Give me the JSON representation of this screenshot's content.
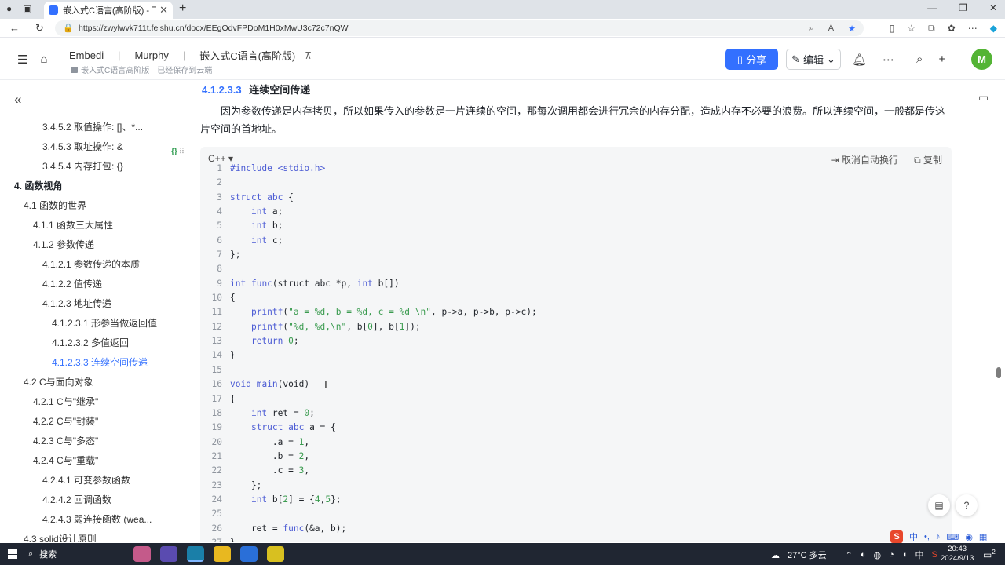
{
  "browser": {
    "tab_title": "嵌入式C语言(高阶版) - 飞书云文档",
    "url": "https://zwylwvk711t.feishu.cn/docx/EEgOdvFPDoM1H0xMwU3c72c7nQW"
  },
  "header": {
    "crumbs": [
      "Embedi",
      "Murphy",
      "嵌入式C语言(高阶版)"
    ],
    "folder": "嵌入式C语言高阶版",
    "save_status": "已经保存到云端",
    "share_label": "分享",
    "edit_label": "编辑",
    "avatar_letter": "M"
  },
  "sidebar": {
    "toc": [
      {
        "label": "3.4.5.2 取值操作: []、*...",
        "level": 3
      },
      {
        "label": "3.4.5.3 取址操作: &",
        "level": 3
      },
      {
        "label": "3.4.5.4 内存打包: {}",
        "level": 3
      },
      {
        "label": "4. 函数视角",
        "level": 0,
        "bold": true
      },
      {
        "label": "4.1 函数的世界",
        "level": 1
      },
      {
        "label": "4.1.1 函数三大属性",
        "level": 2
      },
      {
        "label": "4.1.2 参数传递",
        "level": 2
      },
      {
        "label": "4.1.2.1 参数传递的本质",
        "level": 3
      },
      {
        "label": "4.1.2.2 值传递",
        "level": 3
      },
      {
        "label": "4.1.2.3 地址传递",
        "level": 3
      },
      {
        "label": "4.1.2.3.1 形参当做返回值",
        "level": 4
      },
      {
        "label": "4.1.2.3.2 多值返回",
        "level": 4
      },
      {
        "label": "4.1.2.3.3 连续空间传递",
        "level": 4,
        "active": true
      },
      {
        "label": "4.2 C与面向对象",
        "level": 1
      },
      {
        "label": "4.2.1 C与\"继承\"",
        "level": 2
      },
      {
        "label": "4.2.2 C与\"封装\"",
        "level": 2
      },
      {
        "label": "4.2.3 C与\"多态\"",
        "level": 2
      },
      {
        "label": "4.2.4 C与\"重载\"",
        "level": 2
      },
      {
        "label": "4.2.4.1 可变参数函数",
        "level": 3
      },
      {
        "label": "4.2.4.2 回调函数",
        "level": 3
      },
      {
        "label": "4.2.4.3 弱连接函数 (wea...",
        "level": 3
      },
      {
        "label": "4.3 solid设计原则",
        "level": 1
      }
    ],
    "block_handle": "{}"
  },
  "content": {
    "section_number": "4.1.2.3.3",
    "section_title": "连续空间传递",
    "paragraph": "因为参数传递是内存拷贝，所以如果传入的参数是一片连续的空间，那每次调用都会进行冗余的内存分配，造成内存不必要的浪费。所以连续空间，一般都是传这片空间的首地址。",
    "code": {
      "language": "C++",
      "unwrap_label": "取消自动换行",
      "copy_label": "复制",
      "lines": [
        {
          "n": "1",
          "html": "<span class='kw'>#include</span> <span class='inc'>&lt;stdio.h&gt;</span>"
        },
        {
          "n": "2",
          "html": ""
        },
        {
          "n": "3",
          "html": "<span class='kw'>struct</span> <span class='kw'>abc</span> {"
        },
        {
          "n": "4",
          "html": "    <span class='kw'>int</span> a;"
        },
        {
          "n": "5",
          "html": "    <span class='kw'>int</span> b;"
        },
        {
          "n": "6",
          "html": "    <span class='kw'>int</span> c;"
        },
        {
          "n": "7",
          "html": "};"
        },
        {
          "n": "8",
          "html": ""
        },
        {
          "n": "9",
          "html": "<span class='kw'>int</span> <span class='kw'>func</span>(struct abc *p, <span class='kw'>int</span> b[])"
        },
        {
          "n": "10",
          "html": "{"
        },
        {
          "n": "11",
          "html": "    <span class='kw'>printf</span>(<span class='st'>\"a = %d, b = %d, c = %d \\n\"</span>, p-&gt;a, p-&gt;b, p-&gt;c);"
        },
        {
          "n": "12",
          "html": "    <span class='kw'>printf</span>(<span class='st'>\"%d, %d,\\n\"</span>, b[<span class='nu'>0</span>], b[<span class='nu'>1</span>]);"
        },
        {
          "n": "13",
          "html": "    <span class='kw'>return</span> <span class='nu'>0</span>;"
        },
        {
          "n": "14",
          "html": "}"
        },
        {
          "n": "15",
          "html": ""
        },
        {
          "n": "16",
          "html": "<span class='kw'>void</span> <span class='kw'>main</span>(void)"
        },
        {
          "n": "17",
          "html": "{"
        },
        {
          "n": "18",
          "html": "    <span class='kw'>int</span> ret = <span class='nu'>0</span>;"
        },
        {
          "n": "19",
          "html": "    <span class='kw'>struct</span> <span class='kw'>abc</span> a = {"
        },
        {
          "n": "20",
          "html": "        .a = <span class='nu'>1</span>,"
        },
        {
          "n": "21",
          "html": "        .b = <span class='nu'>2</span>,"
        },
        {
          "n": "22",
          "html": "        .c = <span class='nu'>3</span>,"
        },
        {
          "n": "23",
          "html": "    };"
        },
        {
          "n": "24",
          "html": "    <span class='kw'>int</span> b[<span class='nu'>2</span>] = {<span class='nu'>4</span>,<span class='nu'>5</span>};"
        },
        {
          "n": "25",
          "html": ""
        },
        {
          "n": "26",
          "html": "    ret = <span class='kw'>func</span>(&amp;a, b);"
        },
        {
          "n": "27",
          "html": "}"
        }
      ]
    }
  },
  "taskbar": {
    "search_label": "搜索",
    "weather": "27°C 多云",
    "ime_lang": "中",
    "time": "20:43",
    "date": "2024/9/13",
    "notif_count": "2"
  },
  "colors": {
    "accent": "#3370ff",
    "avatar": "#54b435"
  }
}
